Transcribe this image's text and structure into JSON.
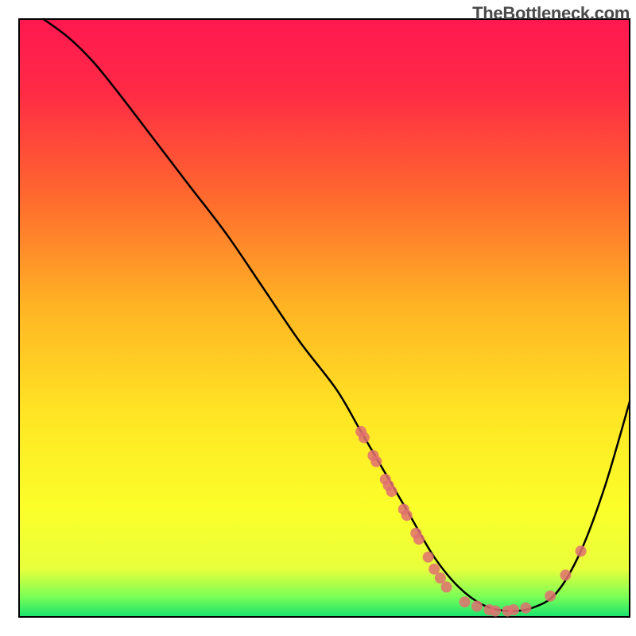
{
  "watermark": "TheBottleneck.com",
  "chart_data": {
    "type": "line",
    "title": "",
    "xlabel": "",
    "ylabel": "",
    "xlim": [
      0,
      100
    ],
    "ylim": [
      0,
      100
    ],
    "background_gradient": {
      "stops": [
        {
          "offset": 0.0,
          "color": "#ff1850"
        },
        {
          "offset": 0.12,
          "color": "#ff2a45"
        },
        {
          "offset": 0.3,
          "color": "#ff6a2e"
        },
        {
          "offset": 0.48,
          "color": "#ffb424"
        },
        {
          "offset": 0.66,
          "color": "#ffe524"
        },
        {
          "offset": 0.82,
          "color": "#fbff2a"
        },
        {
          "offset": 0.92,
          "color": "#e8ff3c"
        },
        {
          "offset": 0.965,
          "color": "#7dff55"
        },
        {
          "offset": 1.0,
          "color": "#18e36f"
        }
      ]
    },
    "series": [
      {
        "name": "bottleneck-curve",
        "color": "#000000",
        "x": [
          4,
          8,
          12,
          16,
          22,
          28,
          34,
          40,
          46,
          52,
          56,
          60,
          64,
          68,
          72,
          76,
          80,
          84,
          88,
          92,
          96,
          100
        ],
        "y": [
          100,
          97,
          93,
          88,
          80,
          72,
          64,
          55,
          46,
          38,
          31,
          24,
          17,
          10,
          5,
          2,
          1,
          1.5,
          4,
          11,
          22,
          36
        ]
      }
    ],
    "scatter": {
      "name": "data-points",
      "color": "#e07070",
      "radius": 7,
      "points": [
        {
          "x": 56,
          "y": 31
        },
        {
          "x": 56.5,
          "y": 30
        },
        {
          "x": 58,
          "y": 27
        },
        {
          "x": 58.5,
          "y": 26
        },
        {
          "x": 60,
          "y": 23
        },
        {
          "x": 60.5,
          "y": 22
        },
        {
          "x": 61,
          "y": 21
        },
        {
          "x": 63,
          "y": 18
        },
        {
          "x": 63.5,
          "y": 17
        },
        {
          "x": 65,
          "y": 14
        },
        {
          "x": 65.5,
          "y": 13
        },
        {
          "x": 67,
          "y": 10
        },
        {
          "x": 68,
          "y": 8
        },
        {
          "x": 69,
          "y": 6.5
        },
        {
          "x": 70,
          "y": 5
        },
        {
          "x": 73,
          "y": 2.5
        },
        {
          "x": 75,
          "y": 1.8
        },
        {
          "x": 77,
          "y": 1.2
        },
        {
          "x": 78,
          "y": 1
        },
        {
          "x": 80,
          "y": 1
        },
        {
          "x": 81,
          "y": 1.2
        },
        {
          "x": 83,
          "y": 1.5
        },
        {
          "x": 87,
          "y": 3.5
        },
        {
          "x": 89.5,
          "y": 7
        },
        {
          "x": 92,
          "y": 11
        }
      ]
    }
  }
}
